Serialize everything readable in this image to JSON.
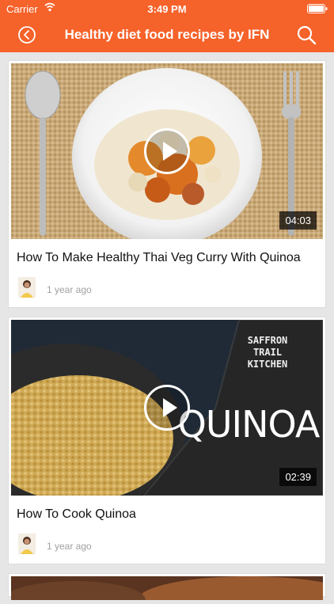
{
  "status": {
    "carrier": "Carrier",
    "time": "3:49 PM"
  },
  "nav": {
    "title": "Healthy diet food recipes by IFN"
  },
  "videos": [
    {
      "title": "How To Make Healthy Thai Veg Curry With Quinoa",
      "duration": "04:03",
      "age": "1 year ago"
    },
    {
      "title": "How To Cook Quinoa",
      "duration": "02:39",
      "age": "1 year ago",
      "thumb_brand": [
        "SAFFRON",
        "TRAIL",
        "KITCHEN"
      ],
      "thumb_word": "QUINOA"
    }
  ],
  "colors": {
    "accent": "#f5622a"
  }
}
